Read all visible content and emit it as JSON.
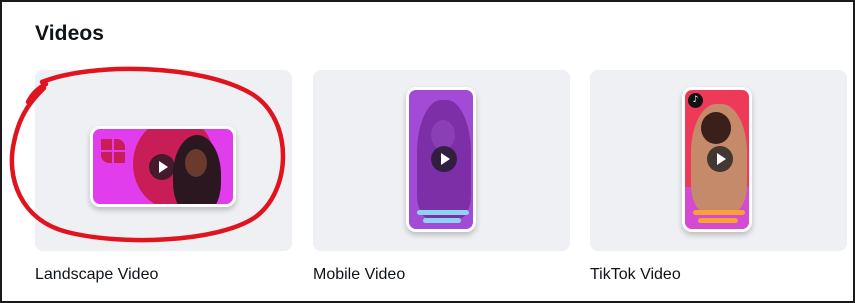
{
  "section": {
    "title": "Videos"
  },
  "cards": [
    {
      "label": "Landscape Video",
      "thumbnail": "landscape-video-thumbnail"
    },
    {
      "label": "Mobile Video",
      "thumbnail": "mobile-video-thumbnail"
    },
    {
      "label": "TikTok Video",
      "thumbnail": "tiktok-video-thumbnail"
    }
  ],
  "icons": {
    "play": "play-icon",
    "tiktok": "tiktok-logo-icon"
  },
  "colors": {
    "card_background": "#eff0f3",
    "text": "#0e1318",
    "magenta": "#e23dec",
    "crimson": "#c81d57",
    "purple": "#a14bd6",
    "coral_red": "#ee3a58",
    "annotation_red": "#e0141e"
  }
}
